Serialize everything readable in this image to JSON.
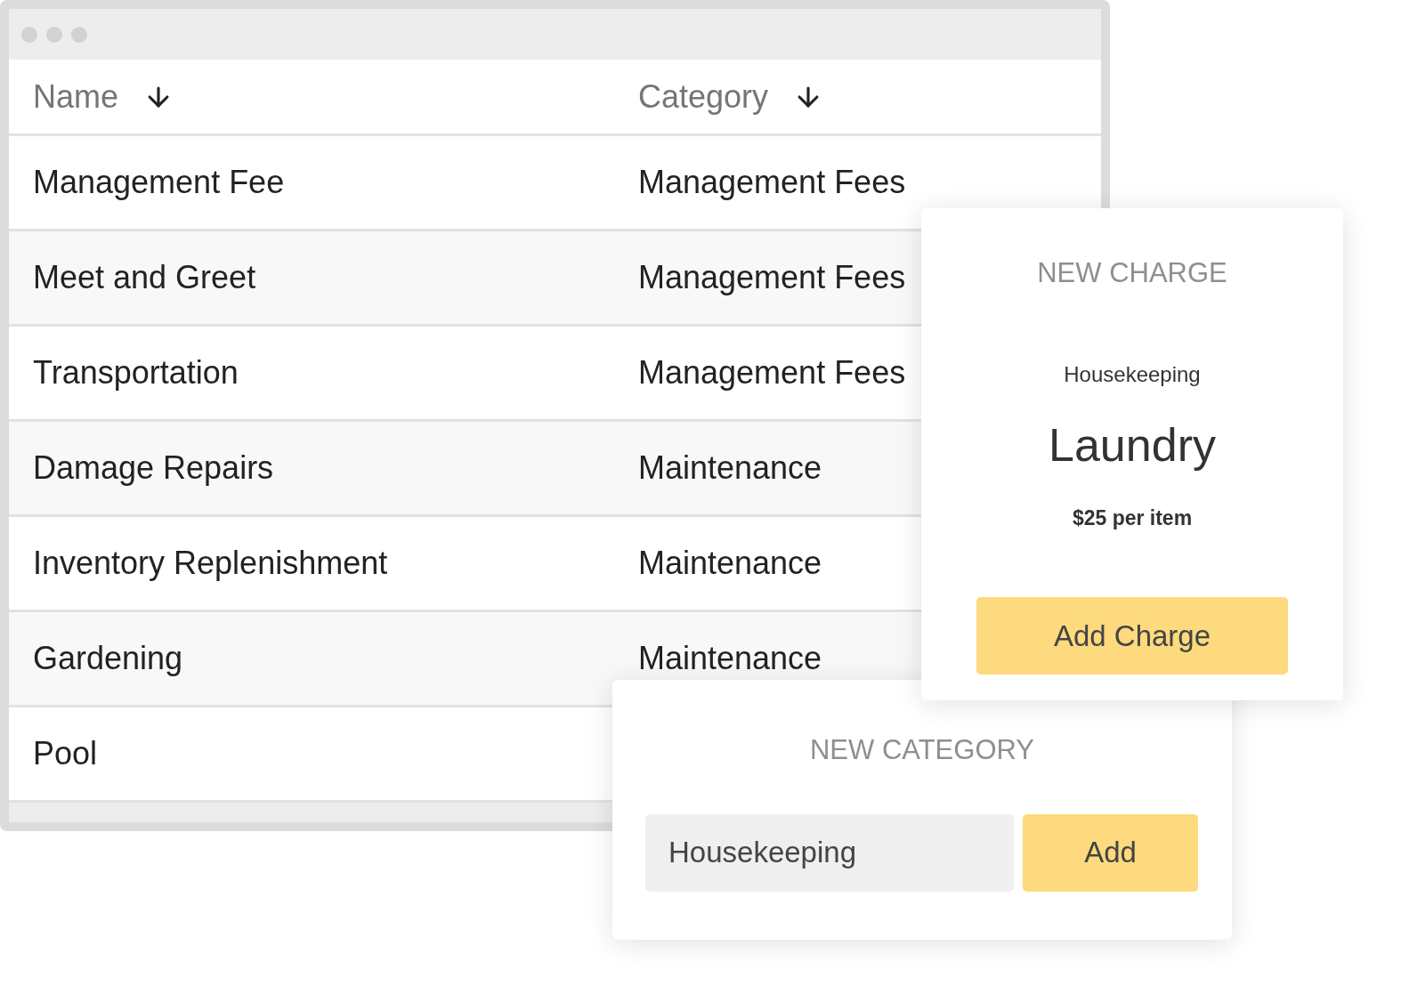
{
  "table": {
    "columns": [
      {
        "label": "Name",
        "sort_descending": true
      },
      {
        "label": "Category",
        "sort_descending": true
      }
    ],
    "rows": [
      {
        "name": "Management Fee",
        "category": "Management Fees"
      },
      {
        "name": "Meet and Greet",
        "category": "Management Fees"
      },
      {
        "name": "Transportation",
        "category": "Management Fees"
      },
      {
        "name": "Damage Repairs",
        "category": "Maintenance"
      },
      {
        "name": "Inventory Replenishment",
        "category": "Maintenance"
      },
      {
        "name": "Gardening",
        "category": "Maintenance"
      },
      {
        "name": "Pool"
      }
    ]
  },
  "new_category": {
    "title": "NEW CATEGORY",
    "field": {
      "value": "Housekeeping"
    },
    "button": "Add"
  },
  "new_charge": {
    "title": "NEW CHARGE",
    "category": "Housekeeping",
    "name": "Laundry",
    "price": "$25 per item",
    "button": "Add Charge"
  }
}
